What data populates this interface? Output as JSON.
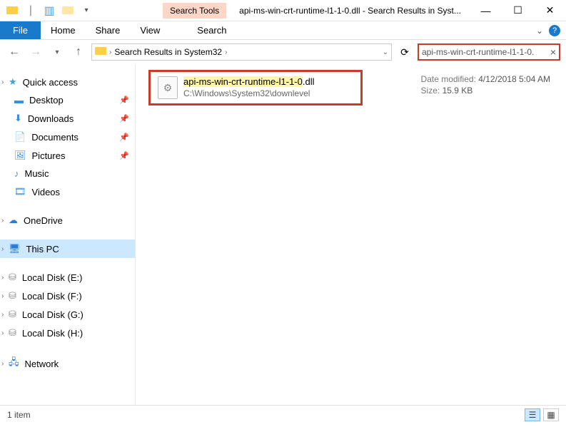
{
  "title": "api-ms-win-crt-runtime-l1-1-0.dll - Search Results in Syst...",
  "search_tools_label": "Search Tools",
  "ribbon": {
    "file": "File",
    "tabs": [
      "Home",
      "Share",
      "View",
      "Search"
    ]
  },
  "address": {
    "segment": "Search Results in System32",
    "search_value": "api-ms-win-crt-runtime-l1-1-0."
  },
  "nav": {
    "quick_access": "Quick access",
    "desktop": "Desktop",
    "downloads": "Downloads",
    "documents": "Documents",
    "pictures": "Pictures",
    "music": "Music",
    "videos": "Videos",
    "onedrive": "OneDrive",
    "this_pc": "This PC",
    "local_e": "Local Disk (E:)",
    "local_f": "Local Disk (F:)",
    "local_g": "Local Disk (G:)",
    "local_h": "Local Disk (H:)",
    "network": "Network"
  },
  "result": {
    "name_hl": "api-ms-win-crt-runtime-l1-1-0",
    "name_ext": ".dll",
    "path": "C:\\Windows\\System32\\downlevel"
  },
  "details": {
    "date_label": "Date modified:",
    "date_value": "4/12/2018 5:04 AM",
    "size_label": "Size:",
    "size_value": "15.9 KB"
  },
  "status": {
    "count": "1 item"
  }
}
